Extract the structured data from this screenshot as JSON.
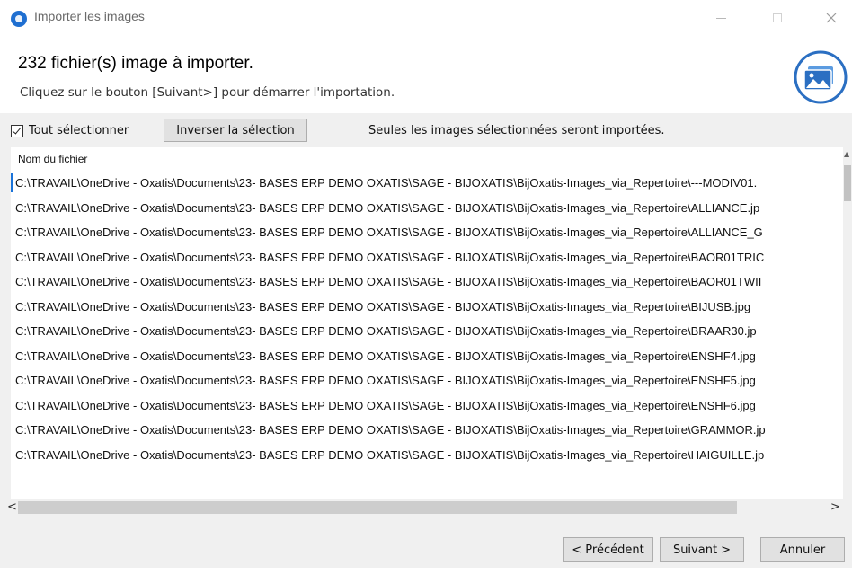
{
  "window": {
    "title": "Importer les images"
  },
  "header": {
    "title": "232 fichier(s) image à importer.",
    "subtitle": "Cliquez sur le bouton [Suivant>] pour démarrer l'importation."
  },
  "toolbar": {
    "select_all_label": "Tout sélectionner",
    "select_all_checked": true,
    "invert_label": "Inverser la sélection",
    "info": "Seules les images sélectionnées seront importées."
  },
  "list": {
    "column_header": "Nom du fichier",
    "rows": [
      "C:\\TRAVAIL\\OneDrive - Oxatis\\Documents\\23- BASES ERP DEMO OXATIS\\SAGE - BIJOXATIS\\BijOxatis-Images_via_Repertoire\\---MODIV01.",
      "C:\\TRAVAIL\\OneDrive - Oxatis\\Documents\\23- BASES ERP DEMO OXATIS\\SAGE - BIJOXATIS\\BijOxatis-Images_via_Repertoire\\ALLIANCE.jp",
      "C:\\TRAVAIL\\OneDrive - Oxatis\\Documents\\23- BASES ERP DEMO OXATIS\\SAGE - BIJOXATIS\\BijOxatis-Images_via_Repertoire\\ALLIANCE_G",
      "C:\\TRAVAIL\\OneDrive - Oxatis\\Documents\\23- BASES ERP DEMO OXATIS\\SAGE - BIJOXATIS\\BijOxatis-Images_via_Repertoire\\BAOR01TRIC",
      "C:\\TRAVAIL\\OneDrive - Oxatis\\Documents\\23- BASES ERP DEMO OXATIS\\SAGE - BIJOXATIS\\BijOxatis-Images_via_Repertoire\\BAOR01TWII",
      "C:\\TRAVAIL\\OneDrive - Oxatis\\Documents\\23- BASES ERP DEMO OXATIS\\SAGE - BIJOXATIS\\BijOxatis-Images_via_Repertoire\\BIJUSB.jpg",
      "C:\\TRAVAIL\\OneDrive - Oxatis\\Documents\\23- BASES ERP DEMO OXATIS\\SAGE - BIJOXATIS\\BijOxatis-Images_via_Repertoire\\BRAAR30.jp",
      "C:\\TRAVAIL\\OneDrive - Oxatis\\Documents\\23- BASES ERP DEMO OXATIS\\SAGE - BIJOXATIS\\BijOxatis-Images_via_Repertoire\\ENSHF4.jpg",
      "C:\\TRAVAIL\\OneDrive - Oxatis\\Documents\\23- BASES ERP DEMO OXATIS\\SAGE - BIJOXATIS\\BijOxatis-Images_via_Repertoire\\ENSHF5.jpg",
      "C:\\TRAVAIL\\OneDrive - Oxatis\\Documents\\23- BASES ERP DEMO OXATIS\\SAGE - BIJOXATIS\\BijOxatis-Images_via_Repertoire\\ENSHF6.jpg",
      "C:\\TRAVAIL\\OneDrive - Oxatis\\Documents\\23- BASES ERP DEMO OXATIS\\SAGE - BIJOXATIS\\BijOxatis-Images_via_Repertoire\\GRAMMOR.jp",
      "C:\\TRAVAIL\\OneDrive - Oxatis\\Documents\\23- BASES ERP DEMO OXATIS\\SAGE - BIJOXATIS\\BijOxatis-Images_via_Repertoire\\HAIGUILLE.jp"
    ]
  },
  "scroll": {
    "left_arrow": "<",
    "right_arrow": ">"
  },
  "buttons": {
    "previous": "< Précédent",
    "next": "Suivant >",
    "cancel": "Annuler"
  },
  "colors": {
    "accent": "#1a73d9",
    "logo": "#2b6fc2"
  },
  "icons": {
    "app": "app-logo-icon",
    "header": "image-icon"
  }
}
